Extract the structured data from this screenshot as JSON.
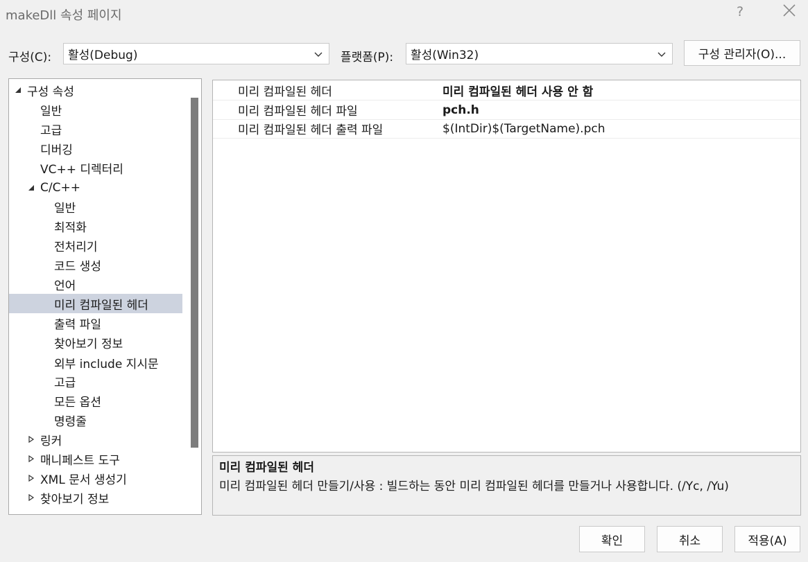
{
  "window": {
    "title": "makeDll 속성 페이지",
    "help": "?",
    "close_icon": "close-icon"
  },
  "toolbar": {
    "config_label": "구성(C):",
    "config_value": "활성(Debug)",
    "platform_label": "플랫폼(P):",
    "platform_value": "활성(Win32)",
    "config_manager": "구성 관리자(O)..."
  },
  "tree": {
    "items": [
      {
        "label": "구성 속성",
        "expander": "expanded"
      },
      {
        "label": "일반"
      },
      {
        "label": "고급"
      },
      {
        "label": "디버깅"
      },
      {
        "label": "VC++ 디렉터리"
      },
      {
        "label": "C/C++",
        "expander": "expanded"
      },
      {
        "label": "일반"
      },
      {
        "label": "최적화"
      },
      {
        "label": "전처리기"
      },
      {
        "label": "코드 생성"
      },
      {
        "label": "언어"
      },
      {
        "label": "미리 컴파일된 헤더",
        "selected": true
      },
      {
        "label": "출력 파일"
      },
      {
        "label": "찾아보기 정보"
      },
      {
        "label": "외부 include 지시문"
      },
      {
        "label": "고급"
      },
      {
        "label": "모든 옵션"
      },
      {
        "label": "명령줄"
      },
      {
        "label": "링커",
        "expander": "collapsed"
      },
      {
        "label": "매니페스트 도구",
        "expander": "collapsed"
      },
      {
        "label": "XML 문서 생성기",
        "expander": "collapsed"
      },
      {
        "label": "찾아보기 정보",
        "expander": "collapsed"
      }
    ]
  },
  "grid": {
    "rows": [
      {
        "name": "미리 컴파일된 헤더",
        "value": "미리 컴파일된 헤더 사용 안 함",
        "bold": true
      },
      {
        "name": "미리 컴파일된 헤더 파일",
        "value": "pch.h",
        "bold": true
      },
      {
        "name": "미리 컴파일된 헤더 출력 파일",
        "value": "$(IntDir)$(TargetName).pch",
        "bold": false
      }
    ]
  },
  "description": {
    "title": "미리 컴파일된 헤더",
    "text": "미리 컴파일된 헤더 만들기/사용 : 빌드하는 동안 미리 컴파일된 헤더를 만들거나 사용합니다.     (/Yc, /Yu)"
  },
  "buttons": {
    "ok": "확인",
    "cancel": "취소",
    "apply": "적용(A)"
  },
  "colors": {
    "selection": "#cdd3df",
    "scroll_thumb": "#7d7d7d",
    "background": "#f0f0f0"
  }
}
